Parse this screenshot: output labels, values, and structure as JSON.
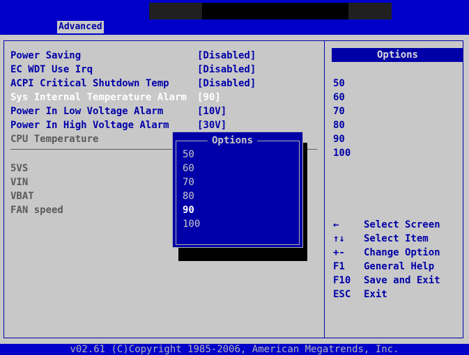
{
  "tabs": {
    "active": "Advanced"
  },
  "settings": [
    {
      "label": "Power Saving",
      "value": "[Disabled]",
      "state": "normal"
    },
    {
      "label": "EC WDT Use Irq",
      "value": "[Disabled]",
      "state": "normal"
    },
    {
      "label": "ACPI Critical Shutdown Temp",
      "value": "[Disabled]",
      "state": "normal"
    },
    {
      "label": "Sys Internal Temperature Alarm",
      "value": "[90]",
      "state": "highlighted"
    },
    {
      "label": "Power In Low Voltage Alarm",
      "value": "[10V]",
      "state": "normal"
    },
    {
      "label": "Power In High Voltage Alarm",
      "value": "[30V]",
      "state": "normal"
    },
    {
      "label": "CPU Temperature",
      "value": "",
      "state": "readonly"
    }
  ],
  "readings": [
    "5VS",
    "VIN",
    "VBAT",
    "FAN speed"
  ],
  "right_panel": {
    "header": "Options",
    "items": [
      "50",
      "60",
      "70",
      "80",
      "90",
      "100"
    ]
  },
  "popup": {
    "title": "Options",
    "items": [
      "50",
      "60",
      "70",
      "80",
      "90",
      "100"
    ],
    "selected": "90"
  },
  "help": [
    {
      "key": "←",
      "text": "Select Screen"
    },
    {
      "key": "↑↓",
      "text": "Select Item"
    },
    {
      "key": "+-",
      "text": "Change Option"
    },
    {
      "key": "F1",
      "text": "General Help"
    },
    {
      "key": "F10",
      "text": "Save and Exit"
    },
    {
      "key": "ESC",
      "text": "Exit"
    }
  ],
  "footer": "v02.61 (C)Copyright 1985-2006, American Megatrends, Inc."
}
